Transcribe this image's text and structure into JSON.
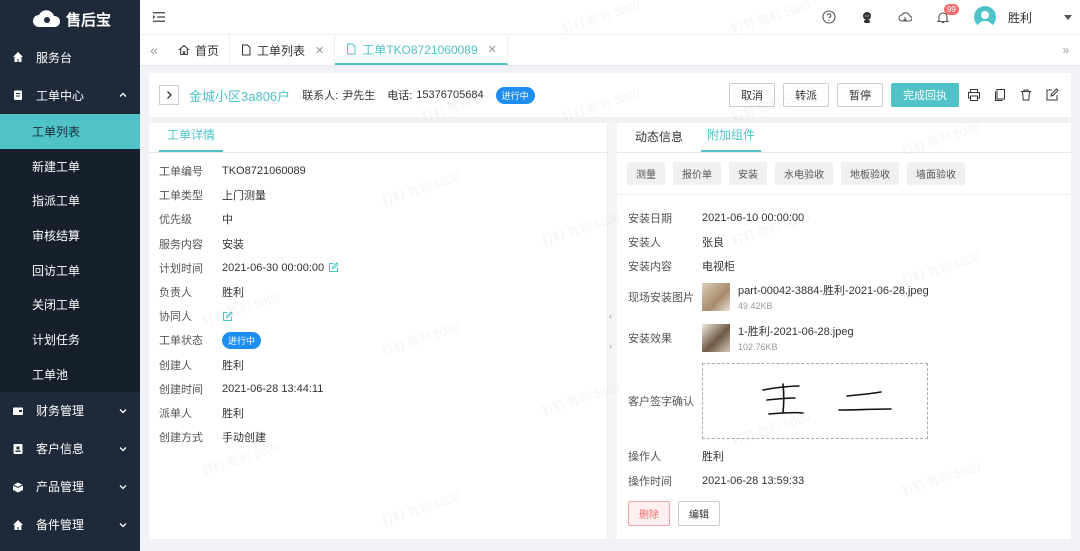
{
  "app": {
    "name": "售后宝"
  },
  "sidebar": {
    "groups": [
      {
        "label": "服务台",
        "icon": "home-icon",
        "expanded": false
      },
      {
        "label": "工单中心",
        "icon": "clipboard-icon",
        "expanded": true,
        "items": [
          "工单列表",
          "新建工单",
          "指派工单",
          "审核结算",
          "回访工单",
          "关闭工单",
          "计划任务",
          "工单池"
        ],
        "active": "工单列表"
      },
      {
        "label": "财务管理",
        "icon": "wallet-icon",
        "expanded": false
      },
      {
        "label": "客户信息",
        "icon": "contact-icon",
        "expanded": false
      },
      {
        "label": "产品管理",
        "icon": "box-icon",
        "expanded": false
      },
      {
        "label": "备件管理",
        "icon": "home-icon",
        "expanded": false
      }
    ]
  },
  "topbar": {
    "user": "胜利",
    "notify_count": "99",
    "icons": [
      "help-icon",
      "person-icon",
      "cloud-icon",
      "bell-icon"
    ]
  },
  "tabs": [
    {
      "label": "首页",
      "icon": "home-icon",
      "closable": false
    },
    {
      "label": "工单列表",
      "icon": "file-icon",
      "closable": true
    },
    {
      "label": "工单TKO8721060089",
      "icon": "file-icon",
      "closable": true,
      "active": true
    }
  ],
  "header": {
    "name": "金城小区3a806户",
    "contact_label": "联系人:",
    "contact": "尹先生",
    "phone_label": "电话:",
    "phone": "15376705684",
    "status": "进行中",
    "buttons": {
      "cancel": "取消",
      "transfer": "转派",
      "pause": "暂停",
      "complete": "完成回执"
    },
    "icons": [
      "print-icon",
      "copy-icon",
      "trash-icon",
      "edit-icon"
    ]
  },
  "detail": {
    "tab": "工单详情",
    "rows": [
      {
        "k": "工单编号",
        "v": "TKO8721060089"
      },
      {
        "k": "工单类型",
        "v": "上门测量"
      },
      {
        "k": "优先级",
        "v": "中"
      },
      {
        "k": "服务内容",
        "v": "安装"
      },
      {
        "k": "计划时间",
        "v": "2021-06-30 00:00:00",
        "editable": true
      },
      {
        "k": "负责人",
        "v": "胜利"
      },
      {
        "k": "协同人",
        "v": "",
        "editable": true
      },
      {
        "k": "工单状态",
        "v": "进行中",
        "pill": true
      },
      {
        "k": "创建人",
        "v": "胜利"
      },
      {
        "k": "创建时间",
        "v": "2021-06-28 13:44:11"
      },
      {
        "k": "派单人",
        "v": "胜利"
      },
      {
        "k": "创建方式",
        "v": "手动创建"
      }
    ]
  },
  "attachments": {
    "tabs": [
      "动态信息",
      "附加组件"
    ],
    "active_tab": "附加组件",
    "chips": [
      "测量",
      "报价单",
      "安装",
      "水电验收",
      "地板验收",
      "墙面验收"
    ],
    "install_date_label": "安装日期",
    "install_date": "2021-06-10 00:00:00",
    "installer_label": "安装人",
    "installer": "张良",
    "content_label": "安装内容",
    "content": "电视柜",
    "photo_label": "现场安装图片",
    "photo_name": "part-00042-3884-胜利-2021-06-28.jpeg",
    "photo_size": "49.42KB",
    "effect_label": "安装效果",
    "effect_name": "1-胜利-2021-06-28.jpeg",
    "effect_size": "102.76KB",
    "signature_label": "客户签字确认",
    "signature_text": "王 二",
    "operator_label": "操作人",
    "operator": "胜利",
    "op_time_label": "操作时间",
    "op_time": "2021-06-28 13:59:33",
    "delete": "删除",
    "edit": "编辑"
  },
  "watermark": "钉钉 胜利 5020",
  "colors": {
    "accent": "#4fc3c7",
    "sidebar": "#1e2a3a",
    "status": "#1f8ef1",
    "danger": "#f56c6c"
  }
}
